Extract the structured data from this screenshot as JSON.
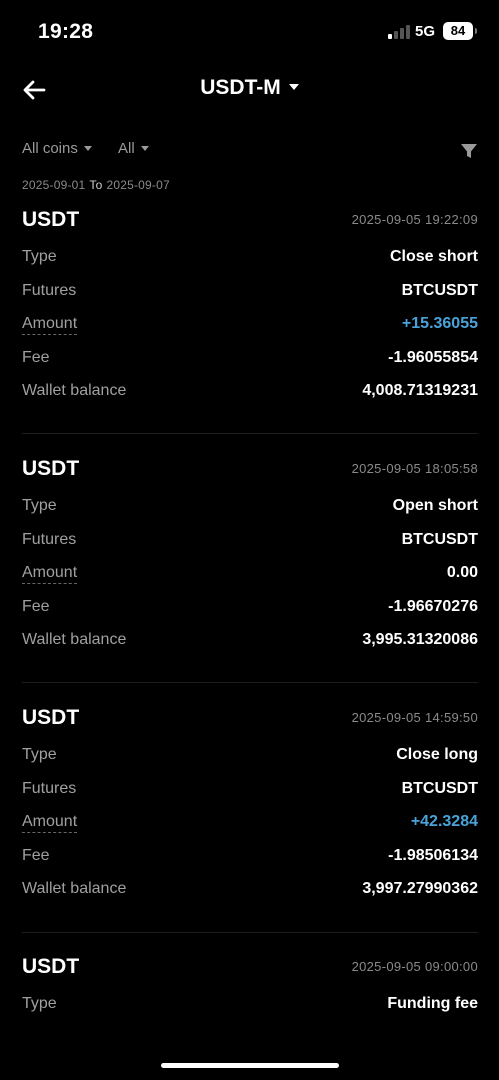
{
  "status_bar": {
    "time": "19:28",
    "network": "5G",
    "battery": "84"
  },
  "header": {
    "title": "USDT-M"
  },
  "filters": {
    "coin": "All coins",
    "type": "All"
  },
  "date_range": {
    "from": "2025-09-01",
    "to_label": "To",
    "to": "2025-09-07"
  },
  "labels": {
    "type": "Type",
    "futures": "Futures",
    "amount": "Amount",
    "fee": "Fee",
    "wallet_balance": "Wallet balance"
  },
  "records": [
    {
      "coin": "USDT",
      "time": "2025-09-05 19:22:09",
      "type": "Close short",
      "futures": "BTCUSDT",
      "amount": "+15.36055",
      "fee": "-1.96055854",
      "wallet_balance": "4,008.71319231"
    },
    {
      "coin": "USDT",
      "time": "2025-09-05 18:05:58",
      "type": "Open short",
      "futures": "BTCUSDT",
      "amount": "0.00",
      "fee": "-1.96670276",
      "wallet_balance": "3,995.31320086"
    },
    {
      "coin": "USDT",
      "time": "2025-09-05 14:59:50",
      "type": "Close long",
      "futures": "BTCUSDT",
      "amount": "+42.3284",
      "fee": "-1.98506134",
      "wallet_balance": "3,997.27990362"
    },
    {
      "coin": "USDT",
      "time": "2025-09-05 09:00:00",
      "type": "Funding fee"
    }
  ],
  "colors": {
    "background": "#000000",
    "positive": "#4aa3d8",
    "muted": "#a0a0a0"
  }
}
